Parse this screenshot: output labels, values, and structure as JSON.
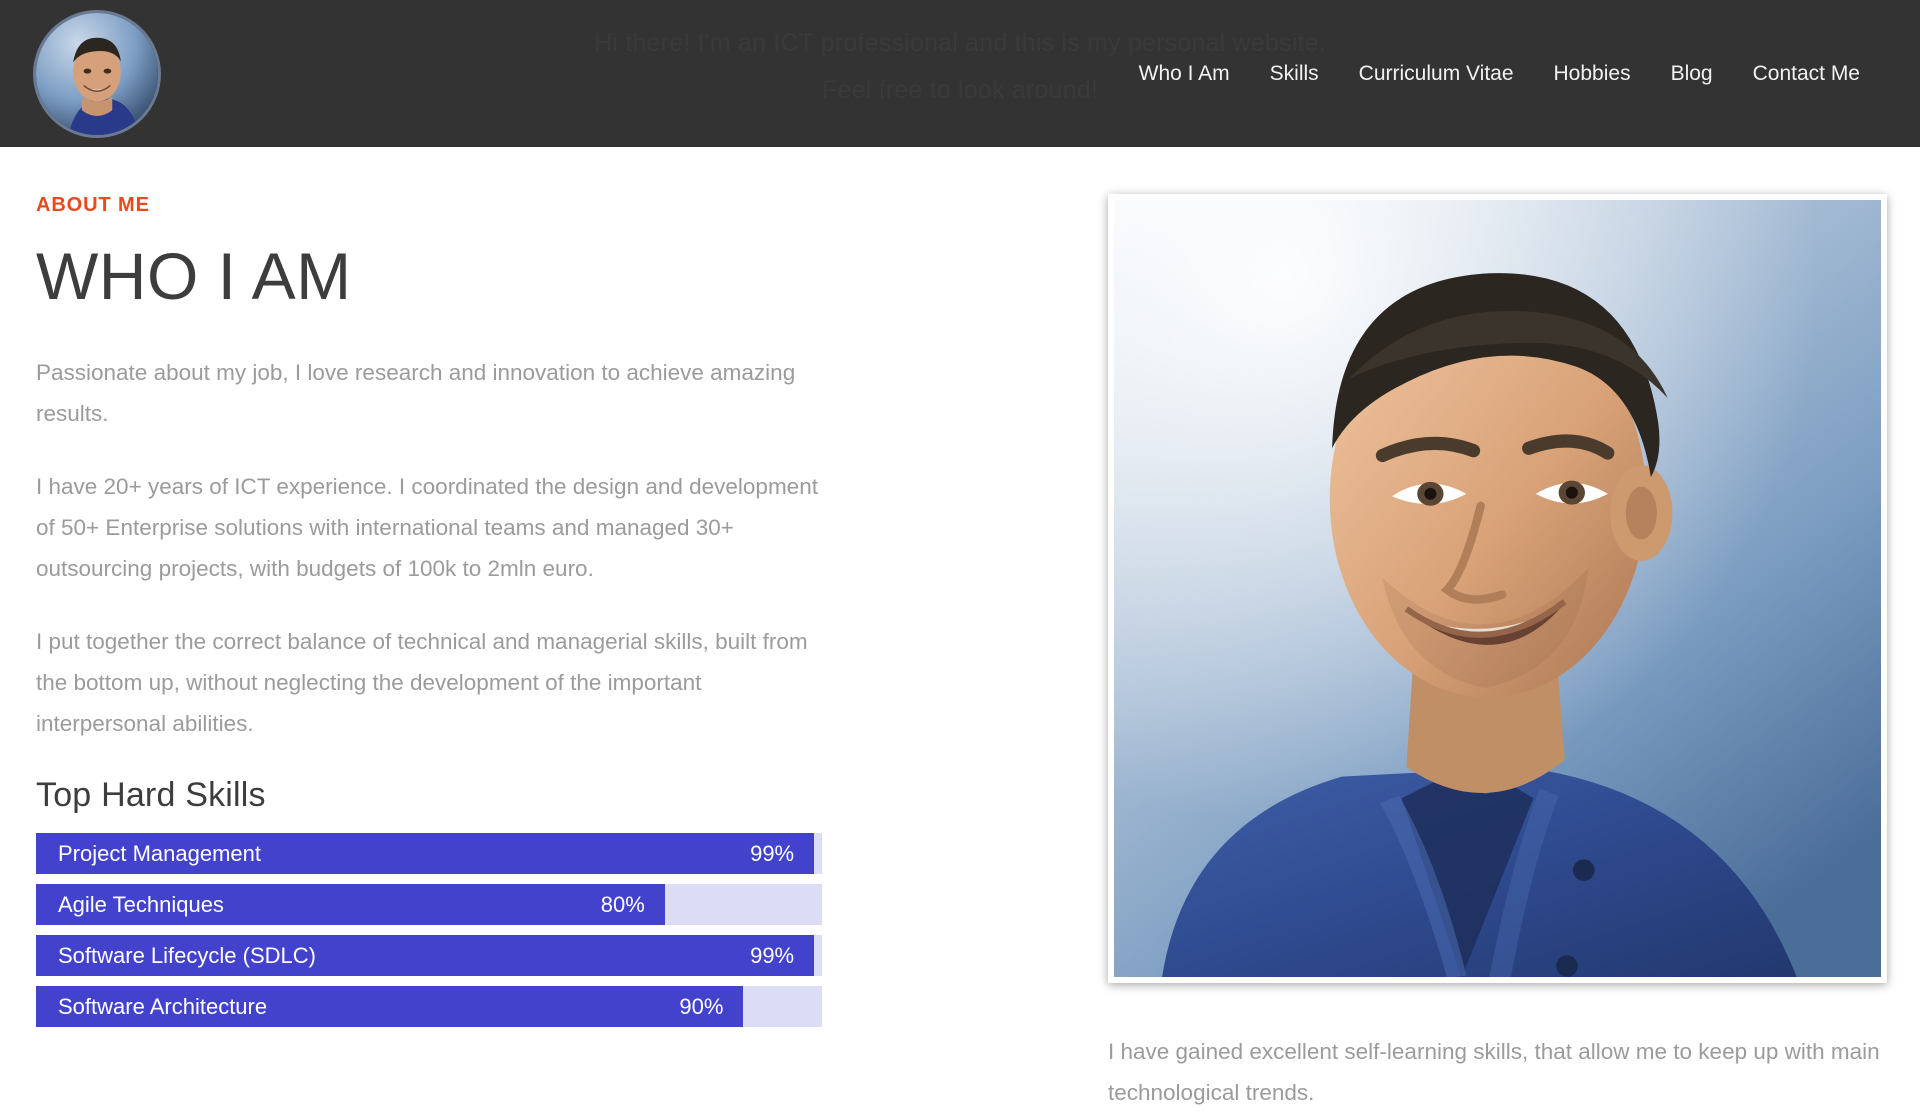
{
  "header": {
    "tagline_line1": "Hi there! I'm an ICT professional and this is my personal website.",
    "tagline_line2": "Feel free to look around!",
    "avatar_alt": "avatar-photo",
    "nav": [
      {
        "label": "Who I Am"
      },
      {
        "label": "Skills"
      },
      {
        "label": "Curriculum Vitae"
      },
      {
        "label": "Hobbies"
      },
      {
        "label": "Blog"
      },
      {
        "label": "Contact Me"
      }
    ]
  },
  "colors": {
    "accent": "#e8491d",
    "header_bg": "#333333",
    "skill_fill": "#4242cd",
    "skill_track": "#dcdcf5",
    "body_text": "#9b9b9b",
    "heading": "#3d3d3d"
  },
  "main": {
    "eyebrow": "ABOUT ME",
    "title": "WHO I AM",
    "paragraphs": [
      "Passionate about my job, I love research and innovation to achieve amazing results.",
      "I have 20+ years of ICT experience. I coordinated the design and development of 50+ Enterprise solutions with international teams and managed 30+ outsourcing projects, with budgets of 100k to 2mln euro.",
      "I put together the correct balance of technical and managerial skills, built from the bottom up, without neglecting the development of the important interpersonal abilities."
    ],
    "skills_heading": "Top Hard Skills",
    "skills": [
      {
        "name": "Project Management",
        "percent_label": "99%",
        "percent": 99
      },
      {
        "name": "Agile Techniques",
        "percent_label": "80%",
        "percent": 80
      },
      {
        "name": "Software Lifecycle (SDLC)",
        "percent_label": "99%",
        "percent": 99
      },
      {
        "name": "Software Architecture",
        "percent_label": "90%",
        "percent": 90
      }
    ],
    "photo_caption": "I have gained excellent self-learning skills, that allow me to keep up with main technological trends."
  }
}
